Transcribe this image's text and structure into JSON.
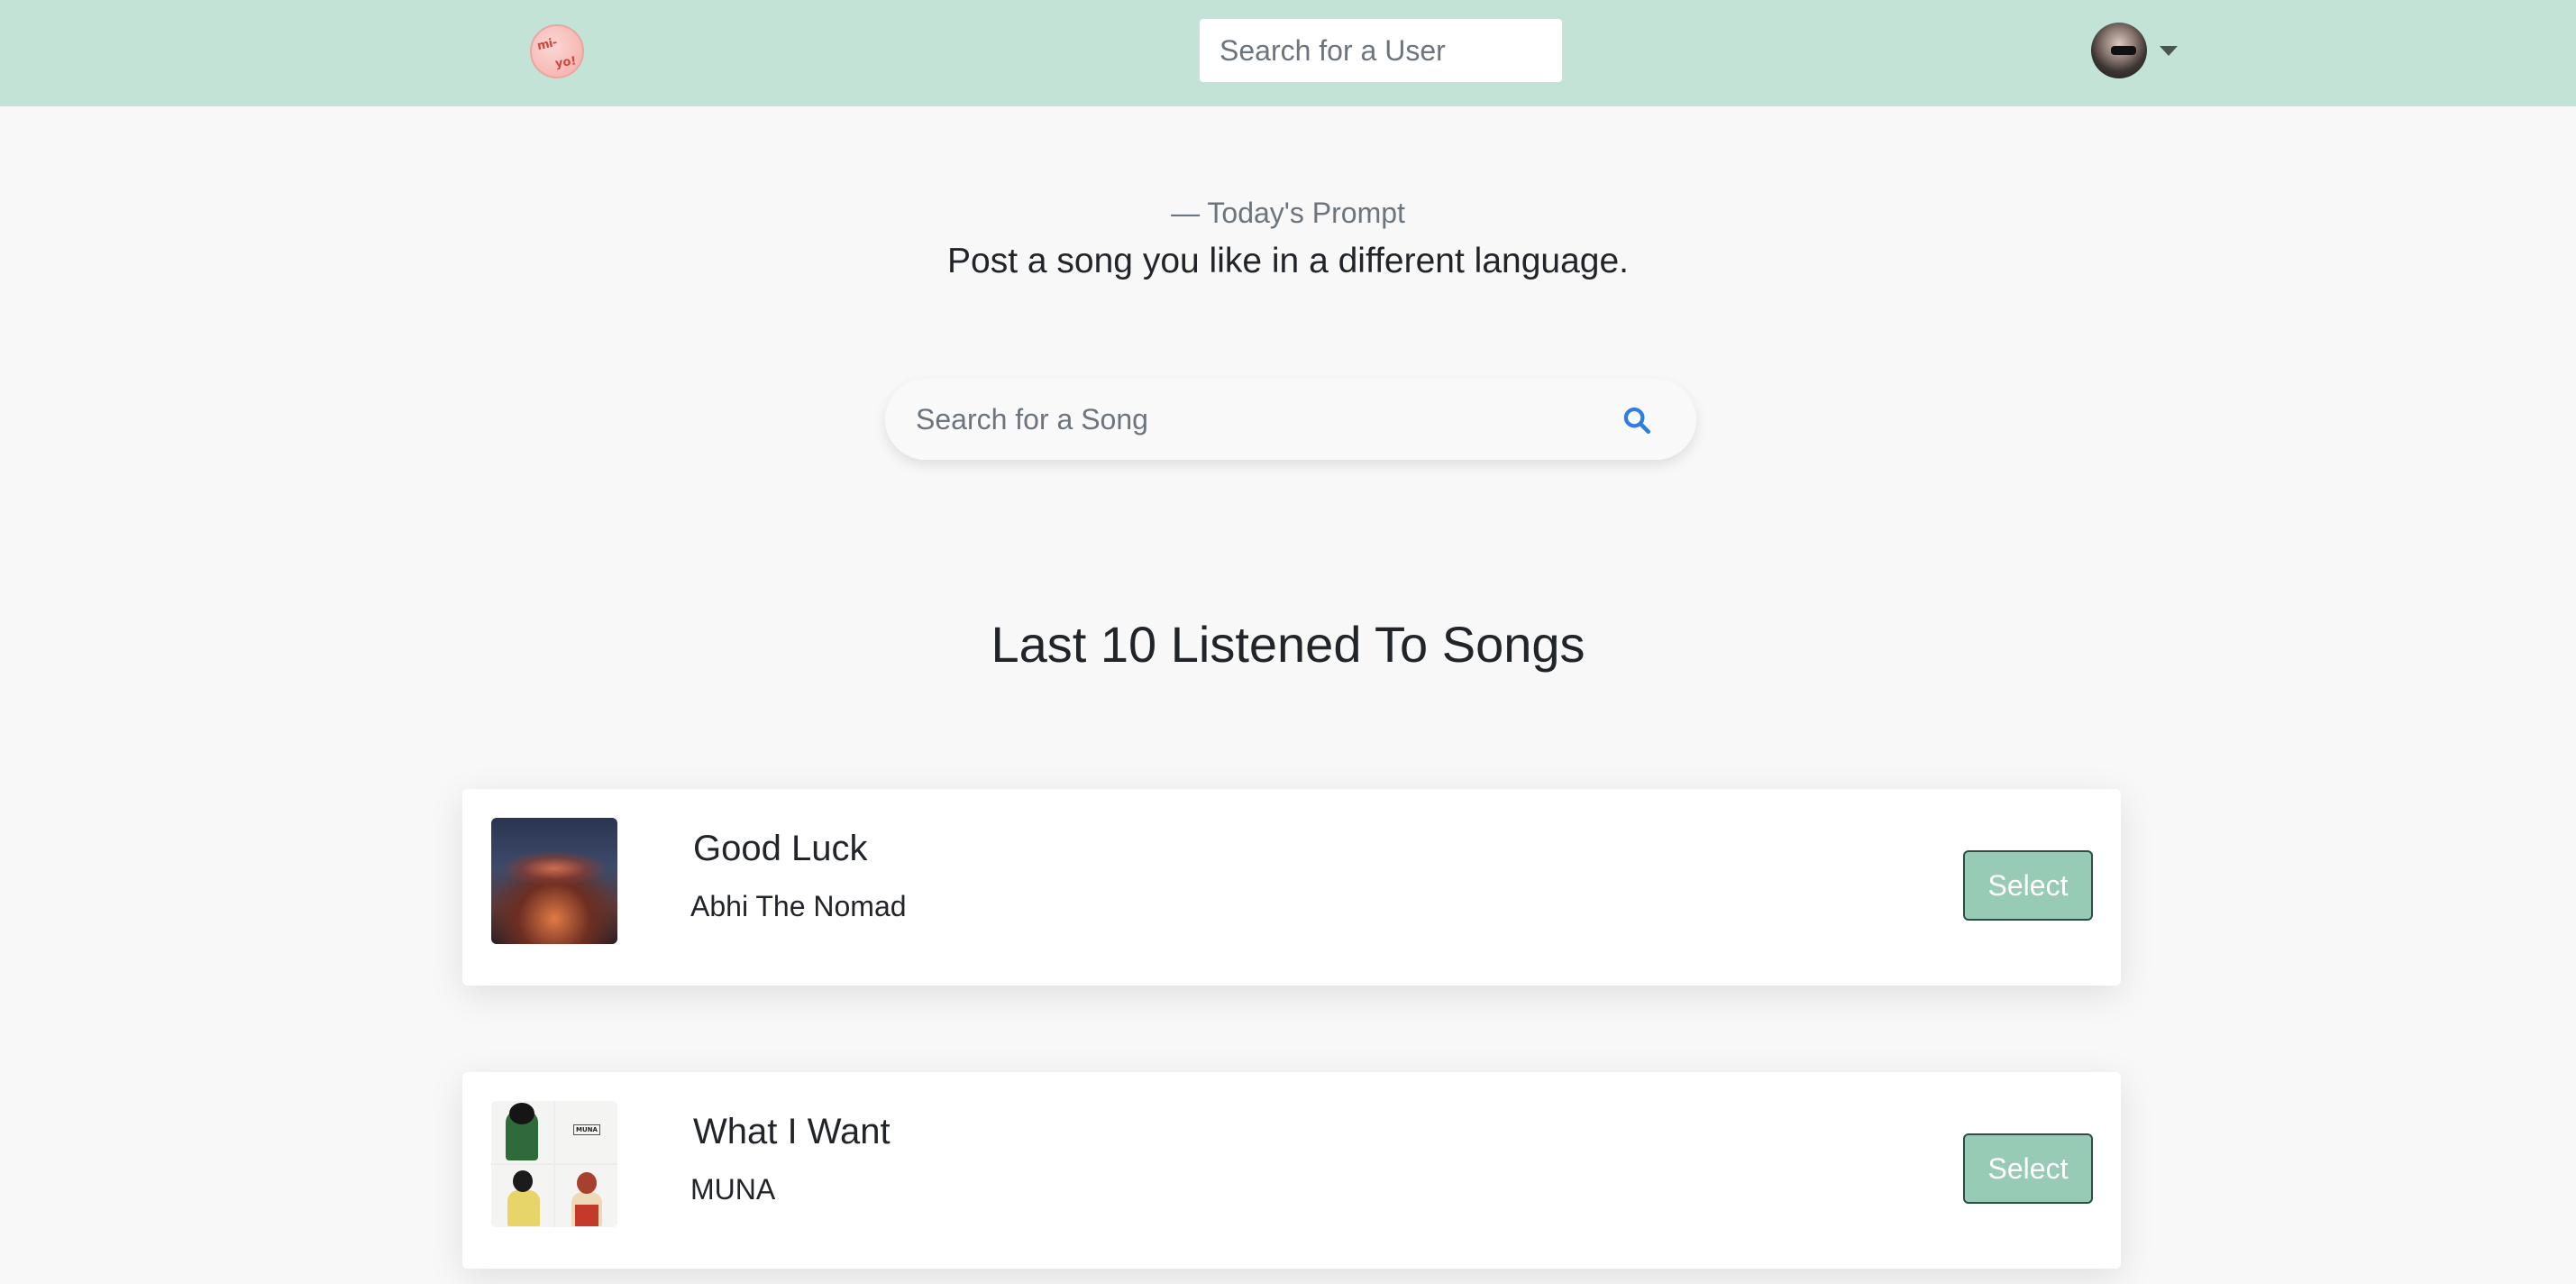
{
  "navbar": {
    "logo_alt": "mixtape logo",
    "user_search_placeholder": "Search for a User",
    "colors": {
      "background": "#c2e3d5"
    }
  },
  "prompt": {
    "label": "— Today's Prompt",
    "text": "Post a song you like in a different language."
  },
  "song_search": {
    "placeholder": "Search for a Song",
    "icon": "search-icon",
    "icon_color": "#2f7de1"
  },
  "section": {
    "title": "Last 10 Listened To Songs"
  },
  "songs": [
    {
      "title": "Good Luck",
      "artist": "Abhi The Nomad",
      "select_label": "Select"
    },
    {
      "title": "What I Want",
      "artist": "MUNA",
      "select_label": "Select"
    }
  ],
  "theme": {
    "select_button": "#98cbb6",
    "select_border": "#2c4f45",
    "page_background": "#f8f8f8"
  }
}
